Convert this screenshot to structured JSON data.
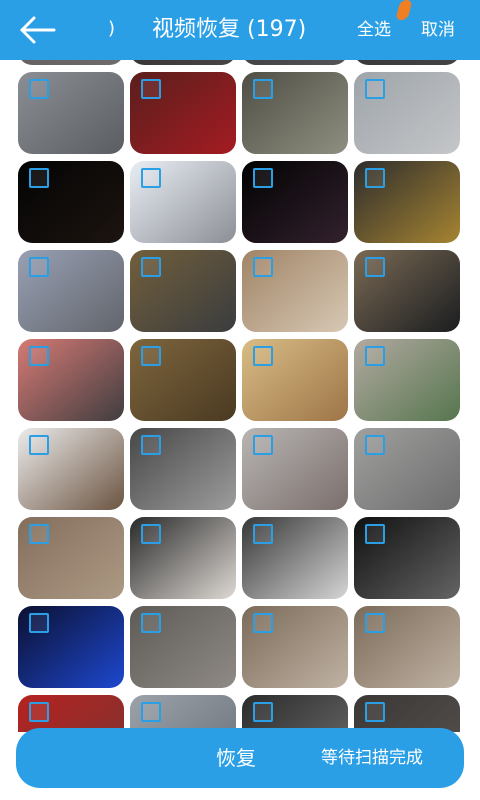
{
  "header": {
    "title": "视频恢复 (197)",
    "select_all": "全选",
    "cancel": "取消",
    "back_icon": "back-arrow-icon"
  },
  "grid": {
    "rows": 9,
    "columns": 4,
    "tiles": [
      {
        "colors": [
          "#5f5a59",
          "#6f6b6a"
        ]
      },
      {
        "colors": [
          "#2d2a2a",
          "#4a4545"
        ]
      },
      {
        "colors": [
          "#333235",
          "#555457"
        ]
      },
      {
        "colors": [
          "#2f2f2f",
          "#444"
        ]
      },
      {
        "colors": [
          "#8b8f95",
          "#5a5d61"
        ]
      },
      {
        "colors": [
          "#5a1f1d",
          "#a41b22"
        ]
      },
      {
        "colors": [
          "#4e4e45",
          "#8f8f80"
        ]
      },
      {
        "colors": [
          "#9ea4aa",
          "#c4c6c8"
        ]
      },
      {
        "colors": [
          "#040404",
          "#1c1410"
        ]
      },
      {
        "colors": [
          "#e9eef4",
          "#8c8f96"
        ]
      },
      {
        "colors": [
          "#020202",
          "#32212e"
        ]
      },
      {
        "colors": [
          "#2d2d2d",
          "#a68431"
        ]
      },
      {
        "colors": [
          "#98a0b4",
          "#62656b"
        ]
      },
      {
        "colors": [
          "#725f3c",
          "#3a3c3e"
        ]
      },
      {
        "colors": [
          "#a08466",
          "#d7c8b4"
        ]
      },
      {
        "colors": [
          "#7a6a54",
          "#1b1d20"
        ]
      },
      {
        "colors": [
          "#d67a74",
          "#403d40"
        ]
      },
      {
        "colors": [
          "#7e653d",
          "#4a3a22"
        ]
      },
      {
        "colors": [
          "#d8bc85",
          "#9e7548"
        ]
      },
      {
        "colors": [
          "#b2a9a1",
          "#56764e"
        ]
      },
      {
        "colors": [
          "#ececec",
          "#6c5441"
        ]
      },
      {
        "colors": [
          "#474747",
          "#9d9d9d"
        ]
      },
      {
        "colors": [
          "#b8b5b3",
          "#7b6f6c"
        ]
      },
      {
        "colors": [
          "#a0a09f",
          "#6d6d6d"
        ]
      },
      {
        "colors": [
          "#836e5c",
          "#ad9a84"
        ]
      },
      {
        "colors": [
          "#2a2a2a",
          "#ded9d4"
        ]
      },
      {
        "colors": [
          "#373737",
          "#d5d5d5"
        ]
      },
      {
        "colors": [
          "#101010",
          "#646464"
        ]
      },
      {
        "colors": [
          "#0c1030",
          "#1d48d0"
        ]
      },
      {
        "colors": [
          "#5e5b57",
          "#8f8a86"
        ]
      },
      {
        "colors": [
          "#7b6b5a",
          "#c0b2a3"
        ]
      },
      {
        "colors": [
          "#7b6b5a",
          "#c0b2a3"
        ]
      },
      {
        "colors": [
          "#b52220",
          "#7a3431"
        ]
      },
      {
        "colors": [
          "#9ba2aa",
          "#6b7077"
        ]
      },
      {
        "colors": [
          "#2b2b2b",
          "#6e6e6e"
        ]
      },
      {
        "colors": [
          "#3b3734",
          "#555250"
        ]
      }
    ]
  },
  "bottom_bar": {
    "recover_label": "恢复",
    "status_label": "等待扫描完成"
  },
  "colors": {
    "accent": "#2a9fe6",
    "checkbox": "#2a9fe6",
    "highlight": "#f07f24"
  },
  "decorations": {
    "left_glyph": ")"
  }
}
